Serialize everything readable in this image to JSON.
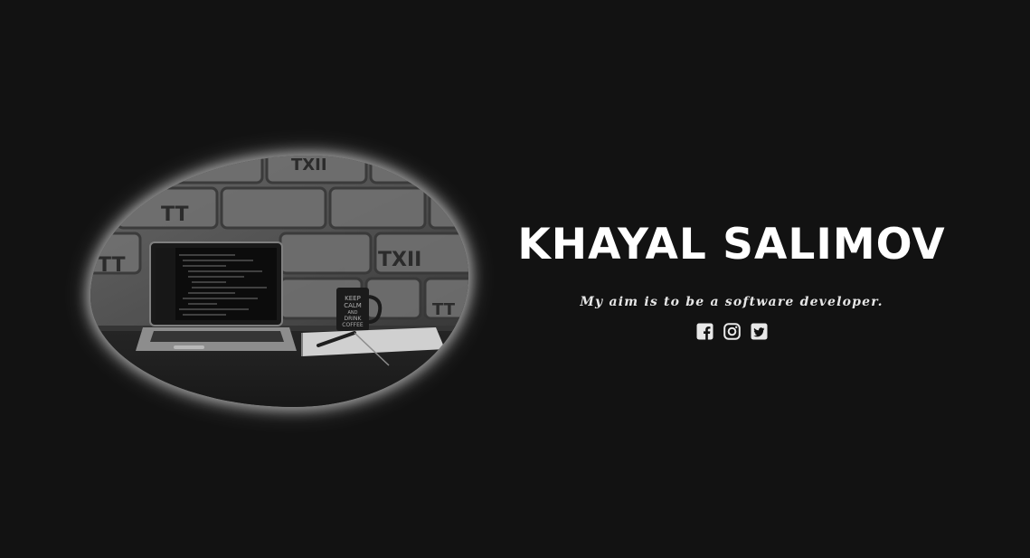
{
  "hero": {
    "name": "KHAYAL SALIMOV",
    "tagline": "My aim is to be a software developer."
  },
  "photo": {
    "mug_text": [
      "KEEP",
      "CALM",
      "AND",
      "DRINK",
      "COFFEE"
    ],
    "wall_marks": [
      "TXII",
      "TT",
      "TT",
      "TXII",
      "TT"
    ]
  },
  "social": {
    "icons": [
      "facebook-icon",
      "instagram-icon",
      "twitter-icon"
    ]
  },
  "colors": {
    "background": "#121212",
    "text": "#ffffff",
    "icon": "#e8e8e8"
  }
}
